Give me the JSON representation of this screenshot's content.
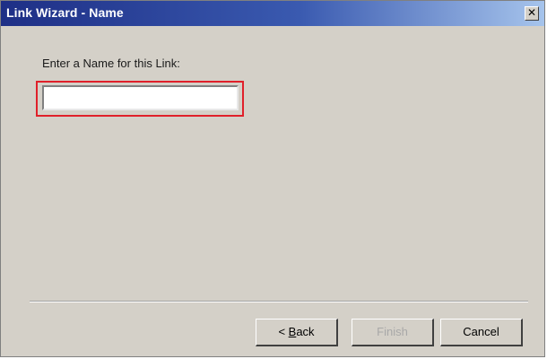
{
  "window": {
    "title": "Link Wizard - Name",
    "close_glyph": "✕"
  },
  "form": {
    "prompt_label": "Enter a Name for this Link:",
    "name_value": "",
    "name_placeholder": ""
  },
  "buttons": {
    "back_prefix": "< ",
    "back_mnemonic": "B",
    "back_rest": "ack",
    "finish_label": "Finish",
    "finish_enabled": false,
    "cancel_label": "Cancel"
  },
  "colors": {
    "title_gradient_start": "#1e2f86",
    "title_gradient_end": "#a6c4ec",
    "dialog_background": "#d4d0c8",
    "highlight_border": "#e0202a",
    "disabled_text": "#a8a8a8"
  },
  "icons": {
    "close": "close-icon"
  }
}
